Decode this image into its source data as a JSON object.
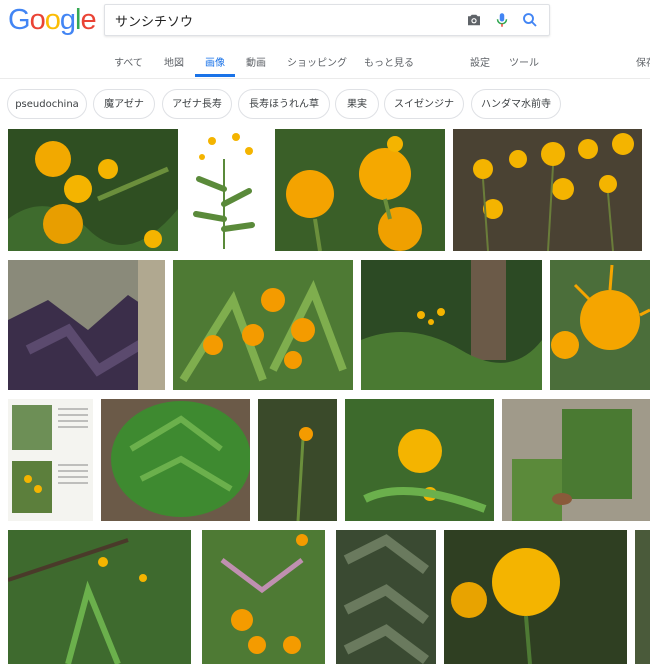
{
  "app": {
    "logo": [
      "G",
      "o",
      "o",
      "g",
      "l",
      "e"
    ],
    "logo_colors": [
      "#4285f4",
      "#ea4335",
      "#fbbc05",
      "#4285f4",
      "#34a853",
      "#ea4335"
    ]
  },
  "search": {
    "query": "サンシチソウ"
  },
  "tabs": {
    "all": "すべて",
    "maps": "地図",
    "images": "画像",
    "videos": "動画",
    "shopping": "ショッピング",
    "more": "もっと見る",
    "settings": "設定",
    "tools": "ツール",
    "safesearch": "保存"
  },
  "chips": [
    "pseudochina",
    "魔アゼナ",
    "アゼナ長寿",
    "長寿ほうれん草",
    "果実",
    "スイゼンジナ",
    "ハンダマ水前寺"
  ],
  "colors": {
    "accent": "#1a73e8",
    "flower": "#f4b400",
    "leaf": "#3b6b2a"
  }
}
